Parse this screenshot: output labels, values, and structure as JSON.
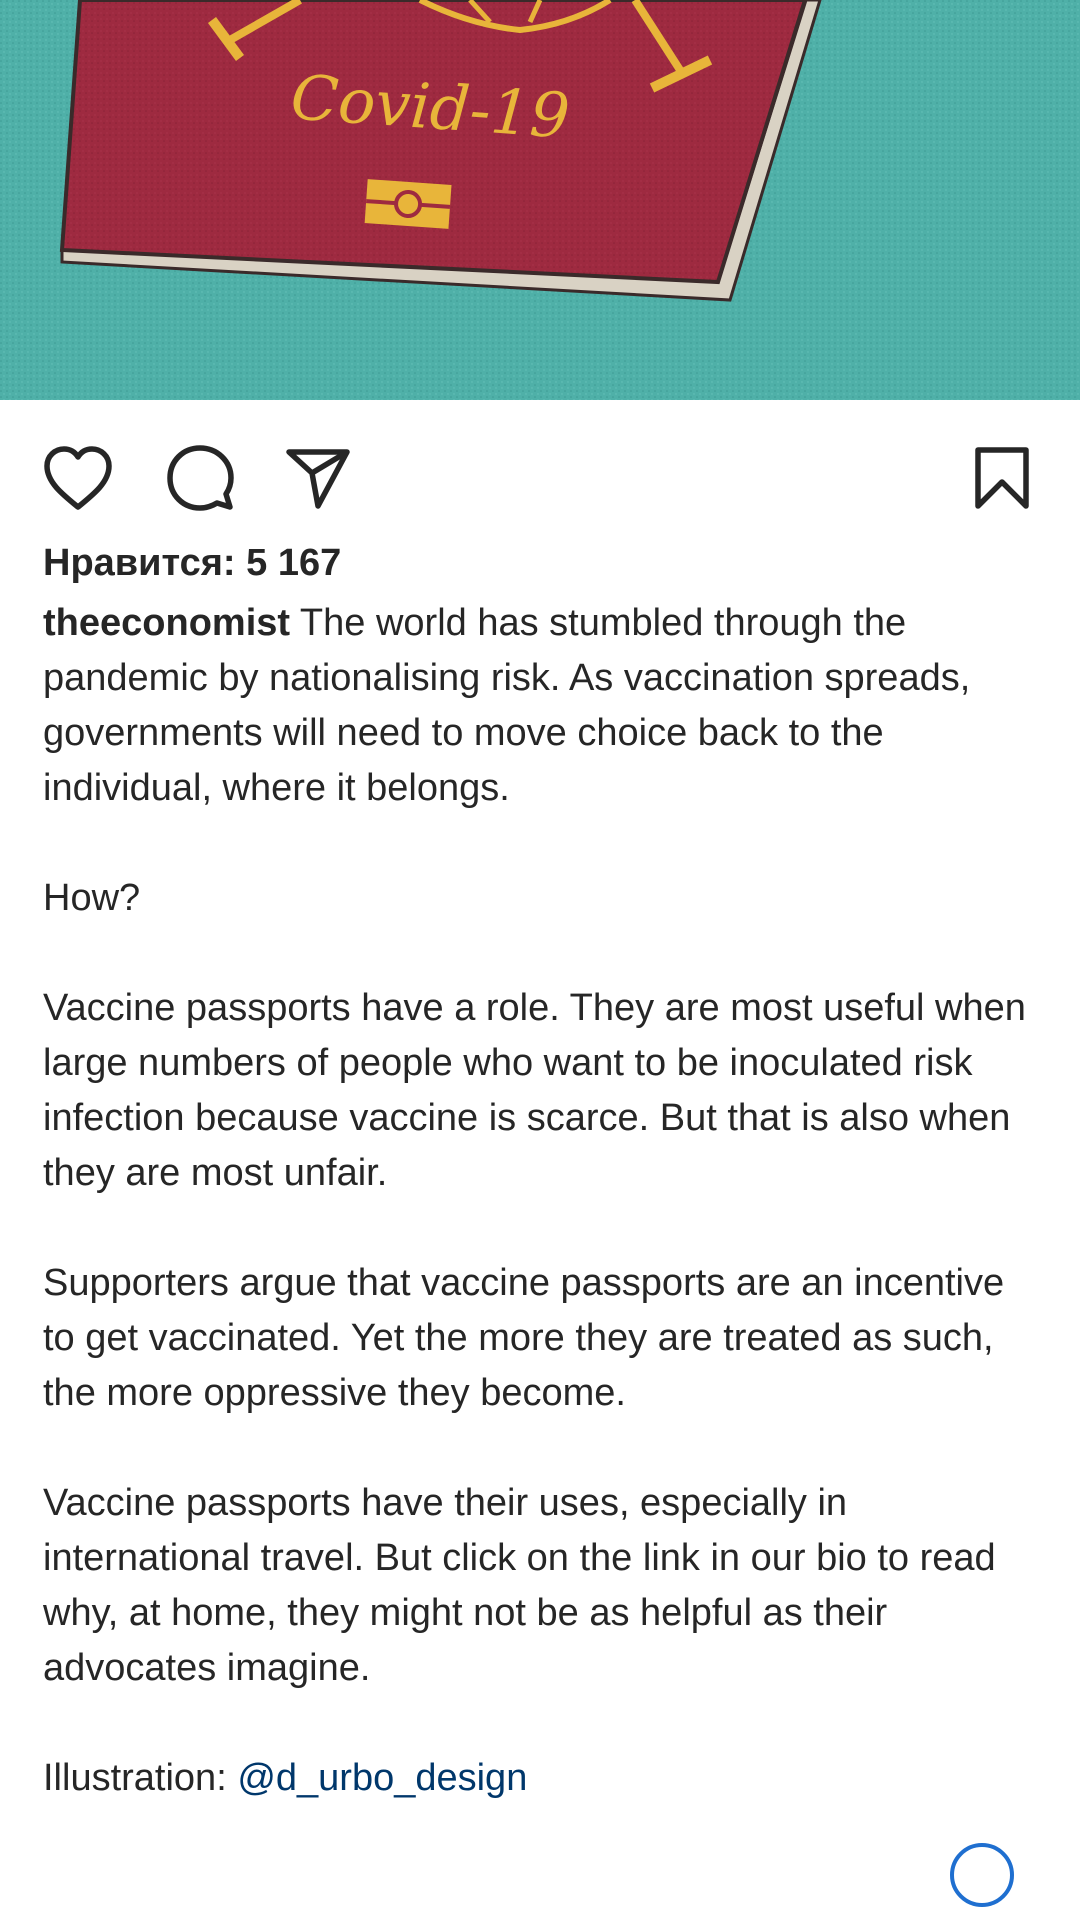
{
  "post": {
    "image": {
      "title_text": "Covid-19",
      "background_color": "#4fb0a8",
      "passport_color": "#9e2a40",
      "gold_color": "#e8b53a"
    },
    "actions": {
      "like_icon": "heart-icon",
      "comment_icon": "comment-icon",
      "share_icon": "paper-plane-icon",
      "save_icon": "bookmark-icon"
    },
    "likes_text": "Нравится: 5 167",
    "caption": {
      "username": "theeconomist",
      "paragraph1": "The world has stumbled through the pandemic by nationalising risk. As vaccination spreads, governments will need to move choice back to the individual, where it belongs.",
      "paragraph2": "How?",
      "paragraph3": "Vaccine passports have a role. They are most useful when large numbers of people who want to be inoculated risk infection because vaccine is scarce. But that is also when they are most unfair.",
      "paragraph4": "Supporters argue that vaccine passports are an incentive to get vaccinated. Yet the more they are treated as such, the more oppressive they become.",
      "paragraph5": "Vaccine passports have their uses, especially in international travel. But click on the link in our bio to read why, at home, they might not be as helpful as their advocates imagine.",
      "illustration_label": "Illustration:",
      "illustration_mention": "@d_urbo_design"
    },
    "colors": {
      "text": "#262626",
      "mention": "#00376b"
    }
  }
}
